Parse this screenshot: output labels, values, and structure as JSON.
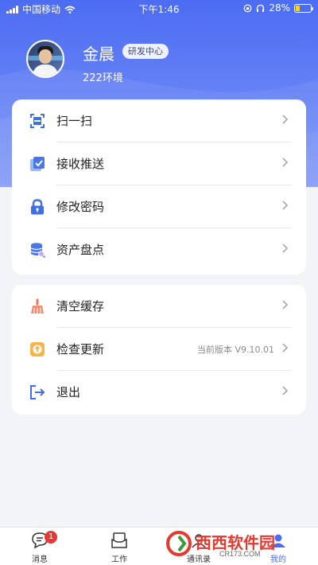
{
  "status_bar": {
    "carrier": "中国移动",
    "time": "下午1:46",
    "battery": "28%",
    "battery_level": 0.28
  },
  "profile": {
    "name": "金晨",
    "department": "研发中心",
    "environment": "222环境"
  },
  "menu_group_1": [
    {
      "label": "扫一扫",
      "icon": "scan-icon"
    },
    {
      "label": "接收推送",
      "icon": "receive-push-icon"
    },
    {
      "label": "修改密码",
      "icon": "lock-icon"
    },
    {
      "label": "资产盘点",
      "icon": "asset-inventory-icon"
    }
  ],
  "menu_group_2": [
    {
      "label": "清空缓存",
      "icon": "broom-icon"
    },
    {
      "label": "检查更新",
      "icon": "update-icon",
      "extra": "当前版本 V9.10.01"
    },
    {
      "label": "退出",
      "icon": "logout-icon"
    }
  ],
  "tabbar": {
    "items": [
      {
        "label": "消息",
        "icon": "message-icon",
        "badge": "1"
      },
      {
        "label": "工作",
        "icon": "work-icon"
      },
      {
        "label": "通讯录",
        "icon": "contacts-icon"
      },
      {
        "label": "我的",
        "icon": "profile-icon",
        "active": true
      }
    ]
  },
  "watermark": {
    "text": "西西软件园",
    "sub": "CR173.COM"
  },
  "colors": {
    "accent": "#4c6cf2",
    "badge": "#e53935"
  }
}
